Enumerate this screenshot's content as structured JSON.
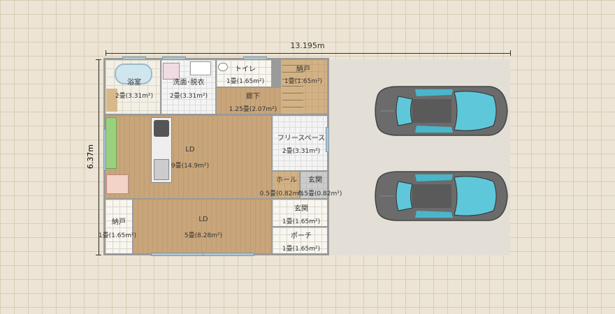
{
  "dimensions": {
    "width_label": "13.195m",
    "height_label": "6.37m"
  },
  "rooms": {
    "bath": {
      "name": "浴室",
      "area": "2畳(3.31m²)"
    },
    "washroom": {
      "name": "洗面･脱衣",
      "area": "2畳(3.31m²)"
    },
    "toilet": {
      "name": "トイレ",
      "area": "1畳(1.65m²)"
    },
    "storage_top": {
      "name": "納戸",
      "area": "1畳(1.65m²)"
    },
    "hallway": {
      "name": "廊下",
      "area": "1.25畳(2.07m²)"
    },
    "ld_main": {
      "name": "LD",
      "area": "9畳(14.9m²)"
    },
    "free_space": {
      "name": "フリースペース",
      "area": "2畳(3.31m²)"
    },
    "hall": {
      "name": "ホール",
      "area": "0.5畳(0.82m²)"
    },
    "entrance_small": {
      "name": "玄関",
      "area": "0.5畳(0.82m²)"
    },
    "storage_bottom": {
      "name": "納戸",
      "area": "1畳(1.65m²)"
    },
    "ld_sub": {
      "name": "LD",
      "area": "5畳(8.28m²)"
    },
    "entrance": {
      "name": "玄関",
      "area": "1畳(1.65m²)"
    },
    "porch": {
      "name": "ポーチ",
      "area": "1畳(1.65m²)"
    }
  },
  "colors": {
    "parking": "#e4dfd6",
    "car_body": "#6b6b6b",
    "car_glass": "#5ec8da",
    "wall": "#9a9a9a"
  }
}
